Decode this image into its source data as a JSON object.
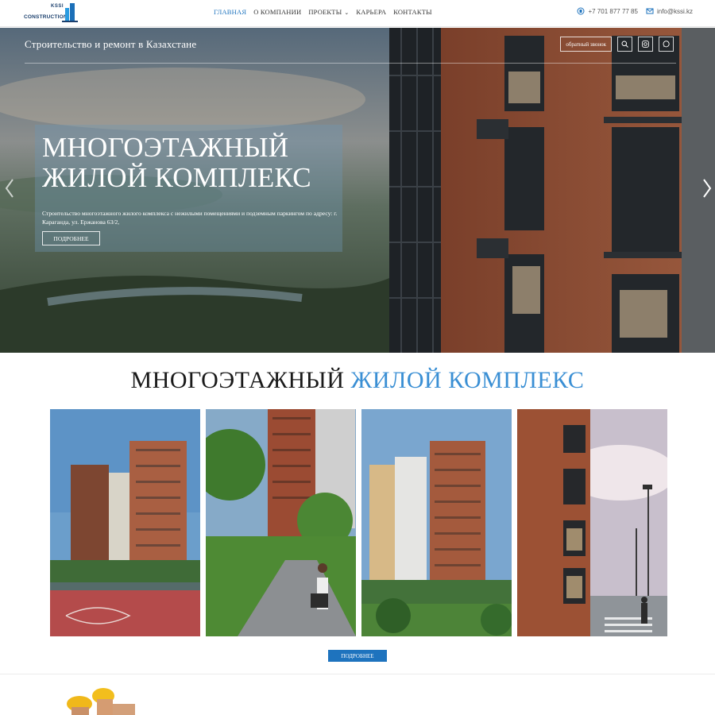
{
  "brand": {
    "logo_top": "KSSI",
    "logo_bottom": "CONSTRUCTION"
  },
  "nav": {
    "items": [
      {
        "label": "ГЛАВНАЯ"
      },
      {
        "label": "О КОМПАНИИ"
      },
      {
        "label": "ПРОЕКТЫ"
      },
      {
        "label": "КАРЬЕРА"
      },
      {
        "label": "КОНТАКТЫ"
      }
    ]
  },
  "contacts": {
    "phone": "+7 701 877 77 85",
    "email": "info@kssi.kz"
  },
  "hero": {
    "tagline": "Строительство и ремонт в Казахстане",
    "callback_label": "обратный звонок",
    "title_line1": "МНОГОЭТАЖНЫЙ",
    "title_line2": "ЖИЛОЙ КОМПЛЕКС",
    "description": "Строительство многоэтажного жилого комплекса с нежилыми помещениями и подземным паркингом по адресу: г. Караганда, ул. Ержанова 63/2,",
    "more_label": "ПОДРОБНЕЕ"
  },
  "section": {
    "title_part1": "МНОГОЭТАЖНЫЙ",
    "title_part2": "ЖИЛОЙ КОМПЛЕКС",
    "more_label": "ПОДРОБНЕЕ"
  },
  "colors": {
    "accent": "#1e73be",
    "highlight": "#3a8fd4",
    "brick": "#8a4a32"
  }
}
